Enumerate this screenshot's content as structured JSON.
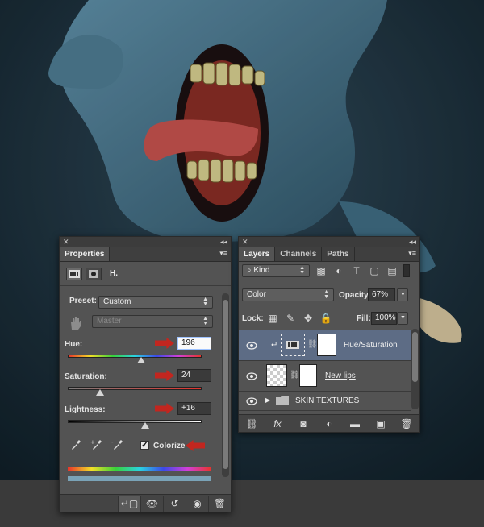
{
  "properties_panel": {
    "tab_label": "Properties",
    "adjustment_title": "H.",
    "preset_label": "Preset:",
    "preset_value": "Custom",
    "channel_value": "Master",
    "hue_label": "Hue:",
    "hue_value": "196",
    "hue_position": 0.55,
    "saturation_label": "Saturation:",
    "saturation_value": "24",
    "saturation_position": 0.24,
    "lightness_label": "Lightness:",
    "lightness_value": "+16",
    "lightness_position": 0.58,
    "colorize_label": "Colorize",
    "colorize_checked": true
  },
  "layers_panel": {
    "tabs": [
      {
        "label": "Layers"
      },
      {
        "label": "Channels"
      },
      {
        "label": "Paths"
      }
    ],
    "filter_label": "Kind",
    "blend_mode": "Color",
    "opacity_label": "Opacity:",
    "opacity_value": "67%",
    "lock_label": "Lock:",
    "fill_label": "Fill:",
    "fill_value": "100%",
    "layers": [
      {
        "name": "Hue/Saturation"
      },
      {
        "name": "New lips"
      },
      {
        "name": "SKIN TEXTURES"
      }
    ],
    "footer_fx": "fx"
  },
  "colors": {
    "panel_bg": "#535353",
    "selection": "#5d6c85",
    "red_arrow": "#c2261f"
  }
}
